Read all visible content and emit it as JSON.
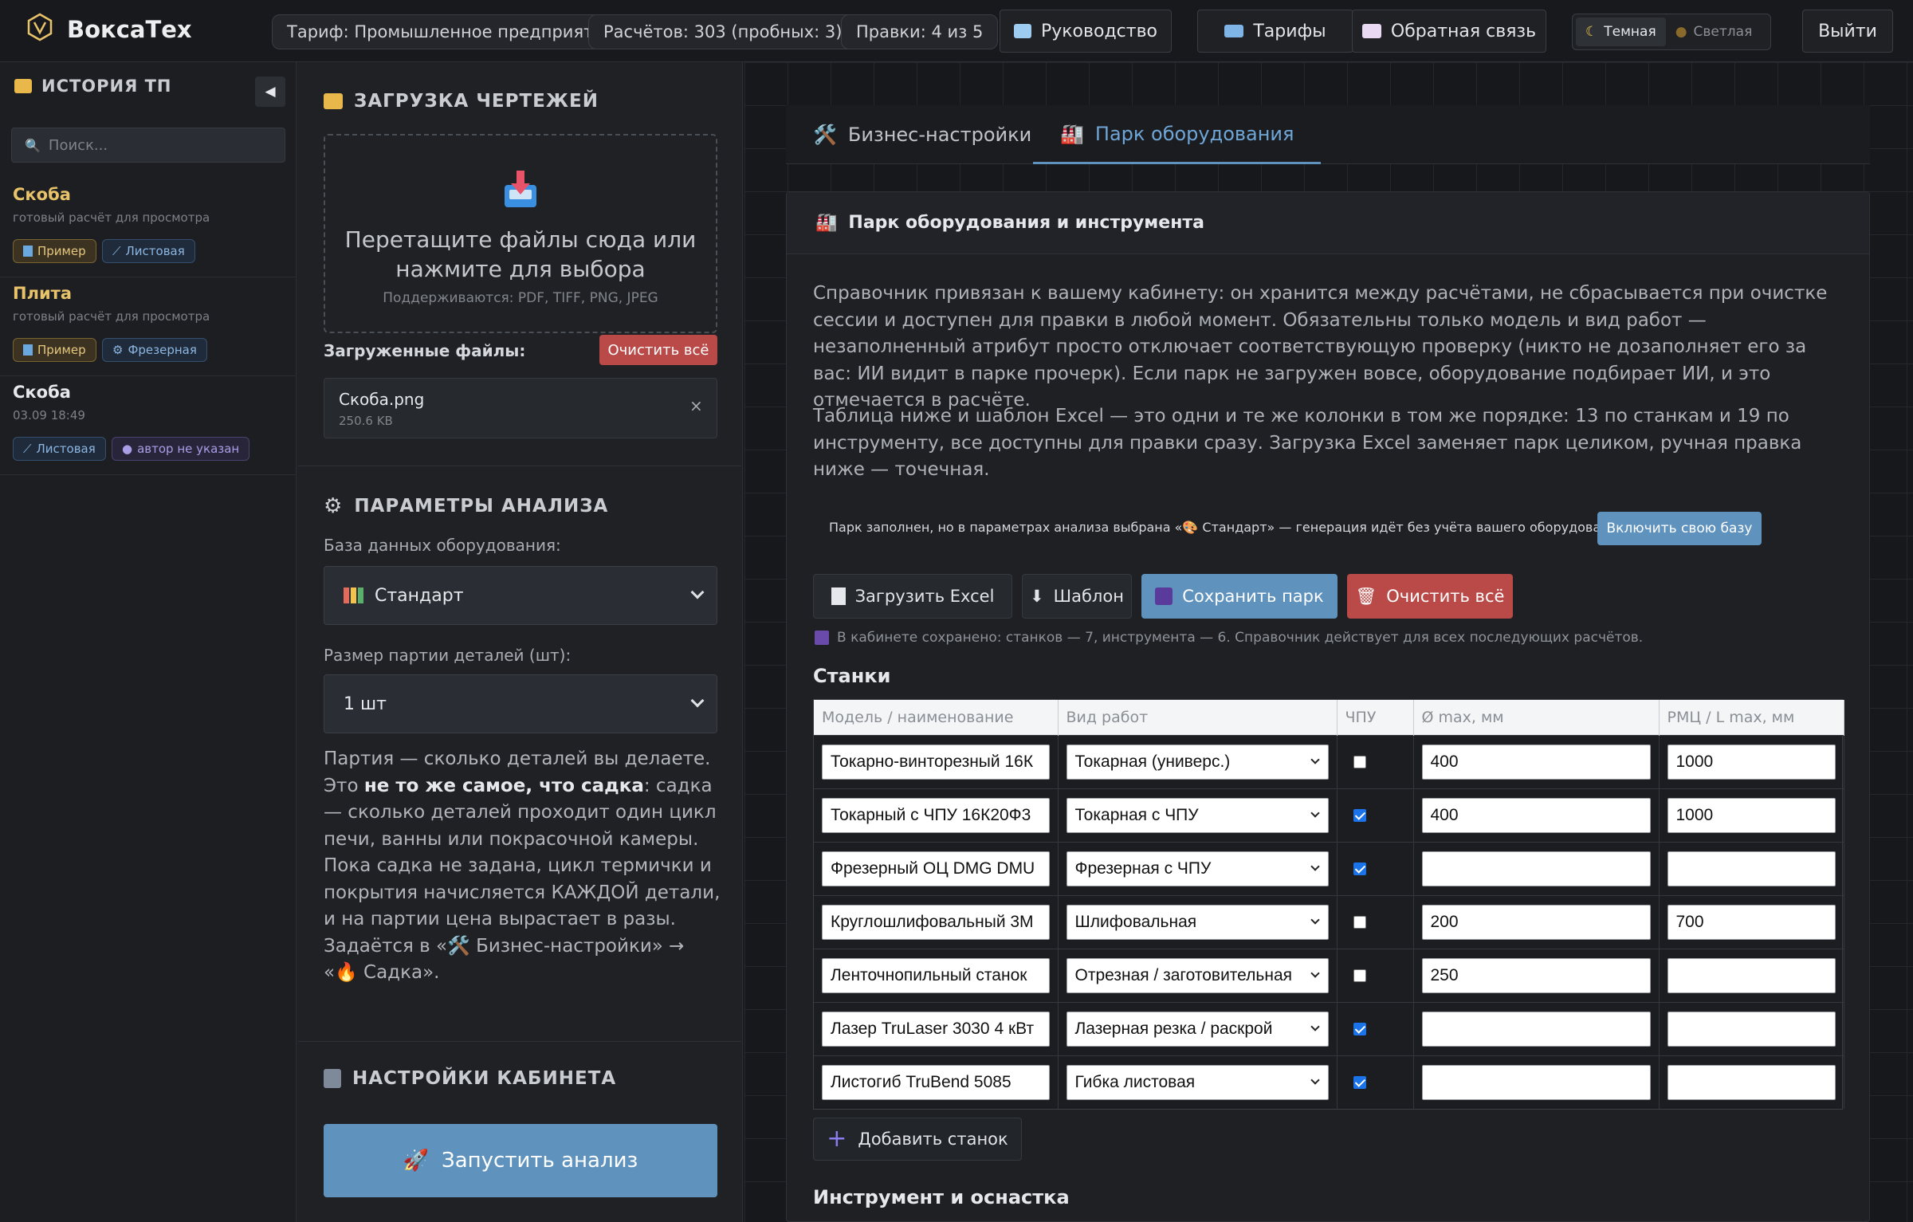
{
  "app": {
    "name": "ВоксаТех"
  },
  "topbar": {
    "tariff": "Тариф: Промышленное предприятие",
    "calcs": "Расчётов: 303 (пробных: 3)",
    "edits": "Правки: 4 из 5",
    "guide": "Руководство",
    "tariffs": "Тарифы",
    "feedback": "Обратная связь",
    "theme_dark": "Темная",
    "theme_light": "Светлая",
    "logout": "Выйти"
  },
  "sidebar": {
    "title": "ИСТОРИЯ ТП",
    "search_placeholder": "Поиск...",
    "items": [
      {
        "title": "Скоба",
        "subtitle": "готовый расчёт для просмотра",
        "tags": [
          "Пример",
          "Листовая"
        ]
      },
      {
        "title": "Плита",
        "subtitle": "готовый расчёт для просмотра",
        "tags": [
          "Пример",
          "Фрезерная"
        ]
      },
      {
        "title": "Скоба",
        "subtitle": "03.09 18:49",
        "tags": [
          "Листовая",
          "автор не указан"
        ]
      }
    ]
  },
  "upload": {
    "title": "ЗАГРУЗКА ЧЕРТЕЖЕЙ",
    "drop_text": "Перетащите файлы сюда или нажмите для выбора",
    "formats": "Поддерживаются: PDF, TIFF, PNG, JPEG",
    "uploaded_label": "Загруженные файлы:",
    "clear_all": "Очистить всё",
    "file": {
      "name": "Скоба.png",
      "size": "250.6 KB"
    }
  },
  "params": {
    "title": "ПАРАМЕТРЫ АНАЛИЗА",
    "db_label": "База данных оборудования:",
    "db_value": "Стандарт",
    "batch_label": "Размер партии деталей (шт):",
    "batch_value": "1 шт",
    "note_1": "Партия — сколько деталей вы делаете. Это ",
    "note_bold": "не то же самое, что садка",
    "note_2": ": садка — сколько деталей проходит один цикл печи, ванны или покрасочной камеры. Пока садка не задана, цикл термички и покрытия начисляется КАЖДОЙ детали, и на партии цена вырастает в разы. Задаётся в «🛠️ Бизнес-настройки» → «🔥 Садка»."
  },
  "cabinet": {
    "title": "НАСТРОЙКИ КАБИНЕТА",
    "run": "Запустить анализ"
  },
  "tabs": [
    {
      "label": "Бизнес-настройки",
      "active": false
    },
    {
      "label": "Парк оборудования",
      "active": true
    }
  ],
  "panel": {
    "title": "Парк оборудования и инструмента",
    "p1": "Справочник привязан к вашему кабинету: он хранится между расчётами, не сбрасывается при очистке сессии и доступен для правки в любой момент. Обязательны только модель и вид работ — незаполненный атрибут просто отключает соответствующую проверку (никто не дозаполняет его за вас: ИИ видит в парке прочерк). Если парк не загружен вовсе, оборудование подбирает ИИ, и это отмечается в расчёте.",
    "p2": "Таблица ниже и шаблон Excel — это одни и те же колонки в том же порядке: 13 по станкам и 19 по инструменту, все доступны для правки сразу. Загрузка Excel заменяет парк целиком, ручная правка ниже — точечная.",
    "notice": "Парк заполнен, но в параметрах анализа выбрана «🎨 Стандарт» — генерация идёт без учёта вашего оборудования.",
    "notice_btn": "Включить свою базу",
    "btn_upload": "Загрузить Excel",
    "btn_template": "Шаблон",
    "btn_save": "Сохранить парк",
    "btn_clear": "Очистить всё",
    "saved_note": "В кабинете сохранено: станков — 7, инструмента — 6. Справочник действует для всех последующих расчётов.",
    "machines_title": "Станки",
    "columns": [
      "Модель / наименование",
      "Вид работ",
      "ЧПУ",
      "Ø max, мм",
      "РМЦ / L max, мм"
    ],
    "rows": [
      {
        "model": "Токарно-винторезный 16К",
        "work": "Токарная (универс.)",
        "cnc": false,
        "dmax": "400",
        "lmax": "1000"
      },
      {
        "model": "Токарный с ЧПУ 16К20Ф3",
        "work": "Токарная с ЧПУ",
        "cnc": true,
        "dmax": "400",
        "lmax": "1000"
      },
      {
        "model": "Фрезерный ОЦ DMG DMU",
        "work": "Фрезерная с ЧПУ",
        "cnc": true,
        "dmax": "",
        "lmax": ""
      },
      {
        "model": "Круглошлифовальный 3М",
        "work": "Шлифовальная",
        "cnc": false,
        "dmax": "200",
        "lmax": "700"
      },
      {
        "model": "Ленточнопильный станок",
        "work": "Отрезная / заготовительная",
        "cnc": false,
        "dmax": "250",
        "lmax": ""
      },
      {
        "model": "Лазер TruLaser 3030 4 кВт",
        "work": "Лазерная резка / раскрой",
        "cnc": true,
        "dmax": "",
        "lmax": ""
      },
      {
        "model": "Листогиб TruBend 5085",
        "work": "Гибка листовая",
        "cnc": true,
        "dmax": "",
        "lmax": ""
      }
    ],
    "add_machine": "Добавить станок",
    "tools_title": "Инструмент и оснастка"
  }
}
